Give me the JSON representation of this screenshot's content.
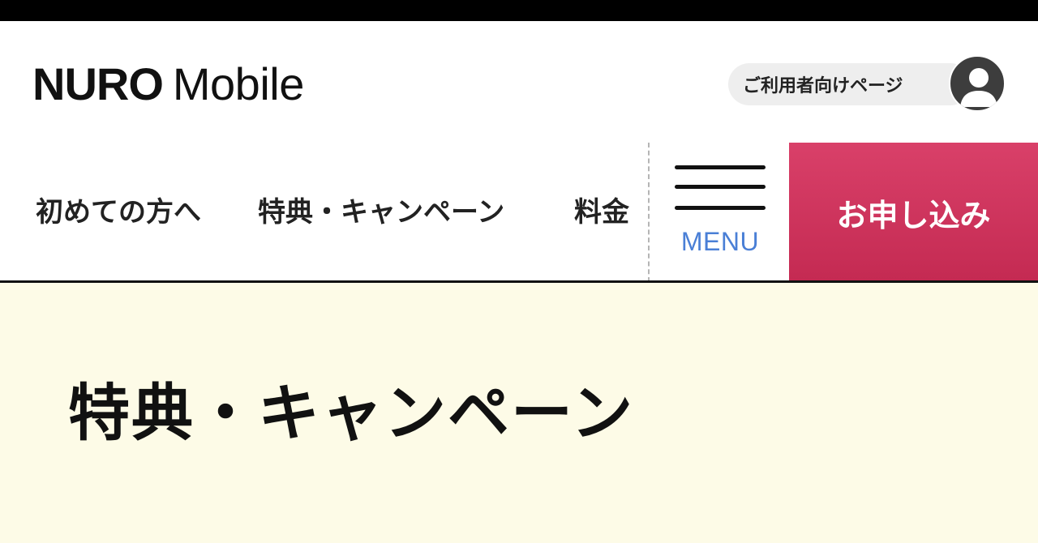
{
  "header": {
    "logo_primary": "NURO",
    "logo_secondary": "Mobile",
    "user_page_label": "ご利用者向けページ"
  },
  "nav": {
    "items": [
      {
        "label": "初めての方へ"
      },
      {
        "label": "特典・キャンペーン"
      },
      {
        "label": "料金"
      }
    ],
    "menu_label": "MENU",
    "apply_label": "お申し込み"
  },
  "hero": {
    "title": "特典・キャンペーン"
  },
  "colors": {
    "apply_button": "#d0335d",
    "menu_text": "#4a7fd6",
    "hero_background": "#fdfbe7",
    "pill_background": "#eeeeee"
  },
  "icons": {
    "menu": "hamburger-icon",
    "user": "user-avatar-icon"
  }
}
